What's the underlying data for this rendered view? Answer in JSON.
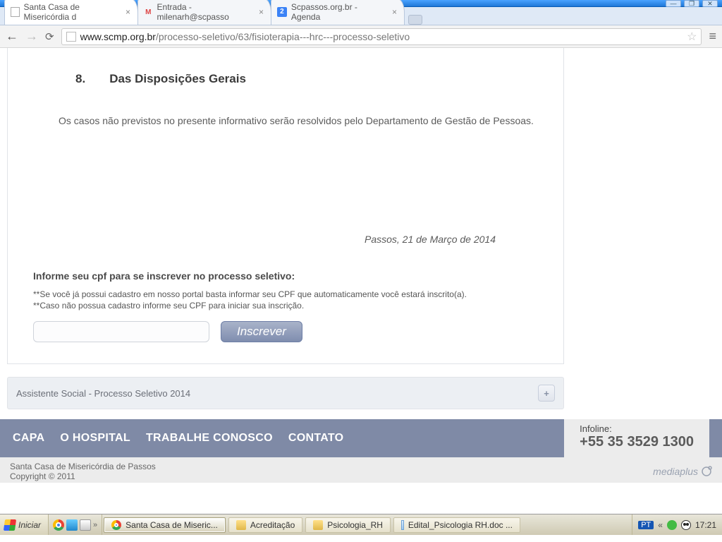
{
  "window": {
    "controls": {
      "min": "—",
      "max": "❐",
      "close": "✕"
    }
  },
  "tabs": [
    {
      "title": "Santa Casa de Misericórdia d",
      "fav": "file"
    },
    {
      "title": "Entrada - milenarh@scpasso",
      "fav": "gmail"
    },
    {
      "title": "Scpassos.org.br - Agenda",
      "fav": "blue2"
    }
  ],
  "url": {
    "host": "www.scmp.org.br",
    "path": "/processo-seletivo/63/fisioterapia---hrc---processo-seletivo"
  },
  "section": {
    "num": "8.",
    "title": "Das Disposições Gerais"
  },
  "body_text": "Os casos não previstos no presente informativo serão resolvidos pelo Departamento de Gestão de Pessoas.",
  "date_line": "Passos, 21 de Março de 2014",
  "cpf_label": "Informe seu cpf para se inscrever no processo seletivo:",
  "hint1": "**Se você já possui cadastro em nosso portal basta informar seu CPF que automaticamente você estará inscrito(a).",
  "hint2": "**Caso não possua cadastro informe seu CPF para iniciar sua inscrição.",
  "inscrever": "Inscrever",
  "related": "Assistente Social - Processo Seletivo 2014",
  "nav": {
    "capa": "CAPA",
    "hosp": "O HOSPITAL",
    "trab": "TRABALHE CONOSCO",
    "cont": "CONTATO"
  },
  "infoline": {
    "label": "Infoline:",
    "number": "+55 35 3529 1300"
  },
  "footer": {
    "org": "Santa Casa de Misericórdia de Passos",
    "copy": "Copyright © 2011",
    "brand": "mediaplus"
  },
  "taskbar": {
    "start": "Iniciar",
    "tasks": [
      {
        "label": "Santa Casa de Miseric...",
        "icon": "chrome",
        "active": true
      },
      {
        "label": "Acreditação",
        "icon": "folder"
      },
      {
        "label": "Psicologia_RH",
        "icon": "folder"
      },
      {
        "label": "Edital_Psicologia RH.doc ...",
        "icon": "doc"
      }
    ],
    "lang": "PT",
    "clock": "17:21"
  }
}
